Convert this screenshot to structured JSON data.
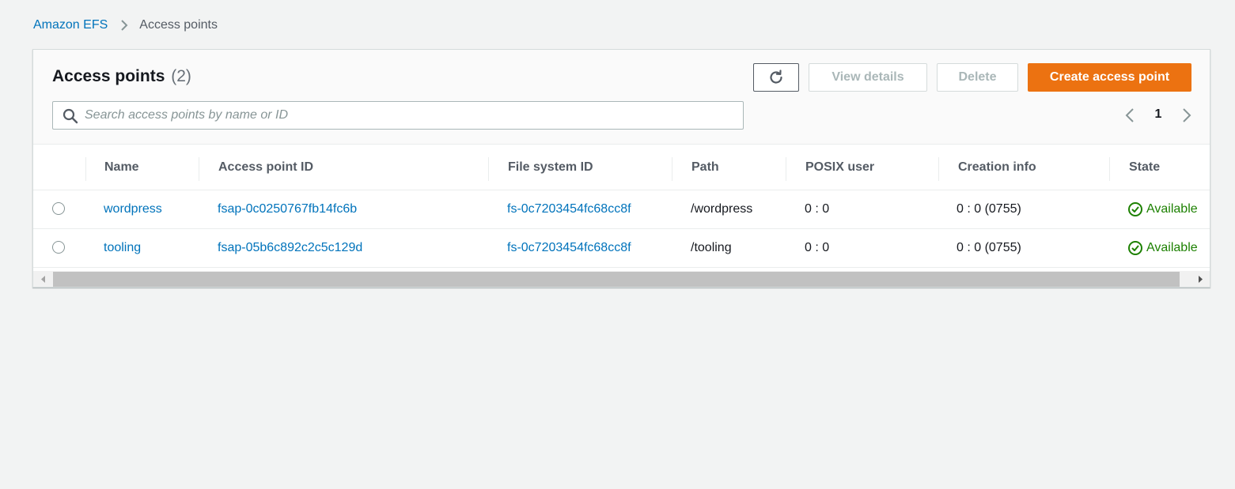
{
  "breadcrumb": {
    "root": "Amazon EFS",
    "current": "Access points"
  },
  "panel": {
    "title": "Access points",
    "count": "(2)"
  },
  "toolbar": {
    "refresh_icon": "refresh-icon",
    "view_details_label": "View details",
    "delete_label": "Delete",
    "create_label": "Create access point"
  },
  "search": {
    "placeholder": "Search access points by name or ID",
    "value": ""
  },
  "pagination": {
    "current_page": "1"
  },
  "table": {
    "columns": [
      "Name",
      "Access point ID",
      "File system ID",
      "Path",
      "POSIX user",
      "Creation info",
      "State"
    ],
    "rows": [
      {
        "name": "wordpress",
        "access_point_id": "fsap-0c0250767fb14fc6b",
        "file_system_id": "fs-0c7203454fc68cc8f",
        "path": "/wordpress",
        "posix_user": "0 : 0",
        "creation_info": "0 : 0 (0755)",
        "state": "Available"
      },
      {
        "name": "tooling",
        "access_point_id": "fsap-05b6c892c2c5c129d",
        "file_system_id": "fs-0c7203454fc68cc8f",
        "path": "/tooling",
        "posix_user": "0 : 0",
        "creation_info": "0 : 0 (0755)",
        "state": "Available"
      }
    ]
  },
  "colors": {
    "link": "#0073bb",
    "primary_button": "#ec7211",
    "success": "#1d8102",
    "background": "#f2f3f3"
  }
}
